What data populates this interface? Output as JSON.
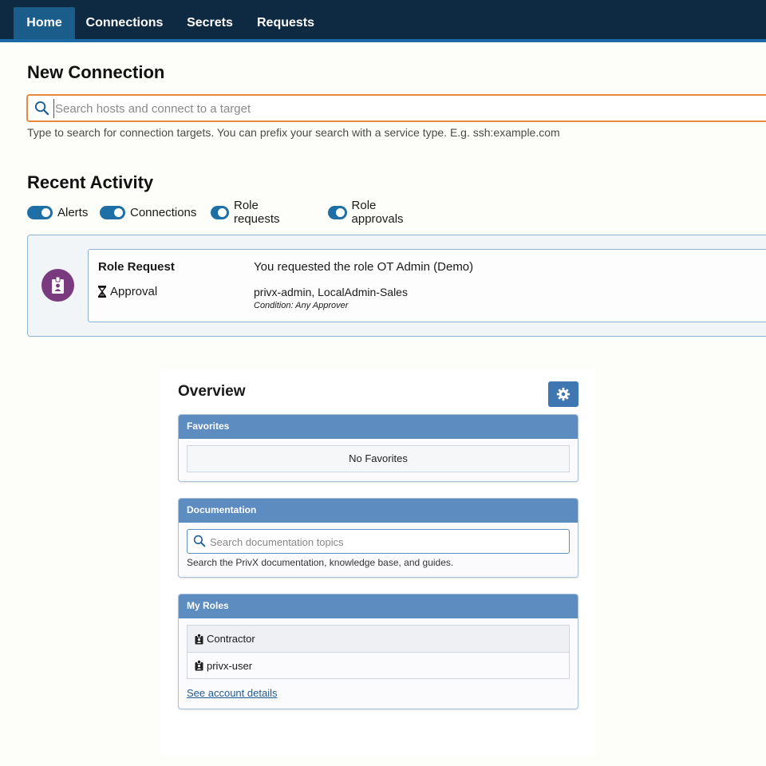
{
  "nav": {
    "tabs": [
      {
        "label": "Home",
        "active": true
      },
      {
        "label": "Connections",
        "active": false
      },
      {
        "label": "Secrets",
        "active": false
      },
      {
        "label": "Requests",
        "active": false
      }
    ]
  },
  "new_connection": {
    "title": "New Connection",
    "search_placeholder": "Search hosts and connect to a target",
    "search_value": "",
    "hint": "Type to search for connection targets. You can prefix your search with a service type. E.g. ssh:example.com"
  },
  "recent_activity": {
    "title": "Recent Activity",
    "filters": [
      {
        "label": "Alerts",
        "on": true
      },
      {
        "label": "Connections",
        "on": true
      },
      {
        "label": "Role requests",
        "on": true
      },
      {
        "label": "Role approvals",
        "on": true
      }
    ],
    "items": [
      {
        "type": "Role Request",
        "message": "You requested the role OT Admin (Demo)",
        "status": "Approval",
        "approvers": "privx-admin, LocalAdmin-Sales",
        "condition": "Condition: Any Approver"
      }
    ]
  },
  "overview": {
    "title": "Overview",
    "favorites": {
      "title": "Favorites",
      "empty_text": "No Favorites"
    },
    "documentation": {
      "title": "Documentation",
      "search_placeholder": "Search documentation topics",
      "hint": "Search the PrivX documentation, knowledge base, and guides."
    },
    "my_roles": {
      "title": "My Roles",
      "roles": [
        "Contractor",
        "privx-user"
      ],
      "link": "See account details"
    }
  },
  "colors": {
    "nav_bg": "#0e2a42",
    "nav_active": "#1b5d8a",
    "accent_orange": "#e8893e",
    "toggle_blue": "#1d6fa5",
    "badge_purple": "#7a3a7e",
    "panel_header": "#5d8dc0"
  },
  "icons": [
    "search-icon",
    "role-badge-icon",
    "hourglass-icon",
    "gear-icon",
    "role-icon"
  ]
}
